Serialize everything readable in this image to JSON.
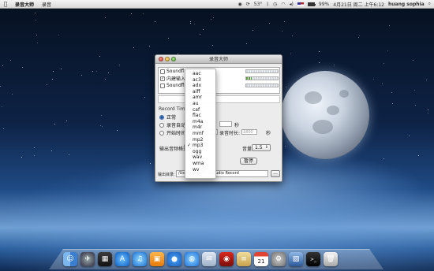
{
  "menubar": {
    "app_name": "录音大师",
    "menu_items": [
      "录音"
    ],
    "battery_percent": 99,
    "battery_text": "99%",
    "temperature": "53°",
    "clock": "4月21日 周二 上午6:12",
    "user": "huang sophia",
    "icons": [
      "apple-icon",
      "spotlight-icon"
    ]
  },
  "window": {
    "title": "录音大师",
    "devices": [
      {
        "label": "Soundflow",
        "checked": false
      },
      {
        "label": "内建输入",
        "checked": true
      },
      {
        "label": "Soundflow",
        "checked": false
      }
    ],
    "record_time": {
      "label": "Record Time:",
      "options": [
        {
          "label": "正常",
          "selected": true
        },
        {
          "label": "录音自动",
          "selected": false
        },
        {
          "label": "开始时间",
          "selected": false
        }
      ],
      "seconds_unit": "秒",
      "duration_label": "录音时长:",
      "duration_value": "1800",
      "duration_unit": "秒"
    },
    "format_label": "输出音频格式:",
    "volume_label": "音量:",
    "volume_value": "1.5",
    "pause_label": "暂停",
    "output_label": "输出目录:",
    "output_path": "/Users/                                             usic/Final Audio Record",
    "browse_label": "..."
  },
  "format_menu": {
    "options": [
      "aac",
      "ac3",
      "adx",
      "aiff",
      "amr",
      "au",
      "caf",
      "flac",
      "m4a",
      "m4r",
      "mmf",
      "mp2",
      "mp3",
      "ogg",
      "wav",
      "wma",
      "wv"
    ],
    "selected": "mp3"
  },
  "dock": {
    "icons": [
      "finder-icon",
      "launchpad-icon",
      "mission-control-icon",
      "app-store-icon",
      "itunes-icon",
      "ibooks-icon",
      "safari-icon",
      "messages-icon",
      "mail-icon",
      "photo-booth-icon",
      "notes-icon",
      "calendar-icon",
      "system-preferences-icon",
      "preview-icon",
      "terminal-icon",
      "trash-icon"
    ]
  },
  "colors": {
    "menubar_bg": "#e6e6e6",
    "window_bg": "#ececec",
    "accent": "#1b4f9c"
  }
}
